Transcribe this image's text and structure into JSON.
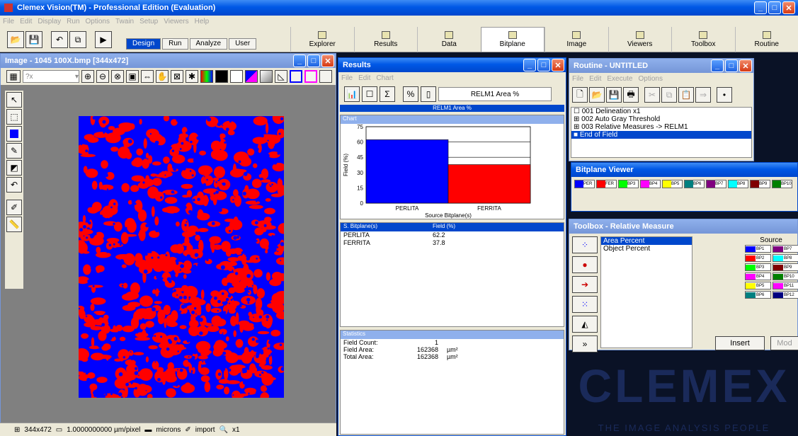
{
  "app": {
    "title": "Clemex Vision(TM) - Professional Edition (Evaluation)",
    "menu": [
      "File",
      "Edit",
      "Display",
      "Run",
      "Options",
      "Twain",
      "Setup",
      "Viewers",
      "Help"
    ]
  },
  "tabs": [
    "Design",
    "Run",
    "Analyze",
    "User"
  ],
  "big_toolbar": [
    {
      "label": "Explorer",
      "icon": "folder-icon"
    },
    {
      "label": "Results",
      "icon": "bar-chart-icon"
    },
    {
      "label": "Data",
      "icon": "data-icon"
    },
    {
      "label": "Bitplane",
      "icon": "bitplane-icon"
    },
    {
      "label": "Image",
      "icon": "image-icon"
    },
    {
      "label": "Viewers",
      "icon": "binoculars-icon"
    },
    {
      "label": "Toolbox",
      "icon": "toolbox-icon"
    },
    {
      "label": "Routine",
      "icon": "routine-icon"
    }
  ],
  "image_window": {
    "title": "Image - 1045 100X.bmp [344x472]",
    "zoom": "?x"
  },
  "statusbar": {
    "dimensions": "344x472",
    "calibration": "1.0000000000 µm/pixel",
    "units": "microns",
    "mode": "import",
    "zoom": "x1"
  },
  "results": {
    "title": "Results",
    "menu": [
      "File",
      "Edit",
      "Chart"
    ],
    "measure": "RELM1 Area %",
    "header_band": "RELM1 Area %",
    "chart_section": "Chart",
    "table_section_cols": [
      "S. Bitplane(s)",
      "Field (%)"
    ],
    "rows": [
      {
        "name": "PERLITA",
        "value": "62.2"
      },
      {
        "name": "FERRITA",
        "value": "37.8"
      }
    ],
    "stats_section": "Statistics",
    "stats": [
      {
        "label": "Field Count:",
        "value": "1",
        "unit": ""
      },
      {
        "label": "Field Area:",
        "value": "162368",
        "unit": "µm²"
      },
      {
        "label": "Total Area:",
        "value": "162368",
        "unit": "µm²"
      }
    ]
  },
  "chart_data": {
    "type": "bar",
    "categories": [
      "PERLITA",
      "FERRITA"
    ],
    "values": [
      62.2,
      37.8
    ],
    "colors": [
      "#0000ff",
      "#ff0000"
    ],
    "xlabel": "Source Bitplane(s)",
    "ylabel": "Field (%)",
    "ylim": [
      0,
      75
    ],
    "yticks": [
      0,
      15,
      30,
      45,
      60,
      75
    ],
    "grid": true
  },
  "routine": {
    "title": "Routine - UNTITLED",
    "menu": [
      "File",
      "Edit",
      "Execute",
      "Options"
    ],
    "items": [
      {
        "prefix": "☐",
        "text": "001  Delineation x1"
      },
      {
        "prefix": "⊞",
        "text": "002  Auto Gray Threshold"
      },
      {
        "prefix": "⊞",
        "text": "003  Relative Measures -> RELM1"
      },
      {
        "prefix": "■",
        "text": "End of Field"
      }
    ]
  },
  "bitplane_viewer": {
    "title": "Bitplane Viewer",
    "chips": [
      {
        "label": "PER",
        "color": "#0000ff"
      },
      {
        "label": "FER",
        "color": "#ff0000"
      },
      {
        "label": "BP3",
        "color": "#00ff00"
      },
      {
        "label": "BP4",
        "color": "#ff00ff"
      },
      {
        "label": "BP5",
        "color": "#ffff00"
      },
      {
        "label": "BP6",
        "color": "#008080"
      },
      {
        "label": "BP7",
        "color": "#800080"
      },
      {
        "label": "BP8",
        "color": "#00ffff"
      },
      {
        "label": "BP9",
        "color": "#800000"
      },
      {
        "label": "BP10",
        "color": "#008000"
      }
    ]
  },
  "toolbox": {
    "title": "Toolbox - Relative Measure",
    "list": [
      "Area Percent",
      "Object Percent"
    ],
    "source_label": "Source",
    "source_chips": [
      {
        "label": "BP1",
        "color": "#0000ff"
      },
      {
        "label": "BP7",
        "color": "#800080"
      },
      {
        "label": "BP2",
        "color": "#ff0000"
      },
      {
        "label": "BP8",
        "color": "#00ffff"
      },
      {
        "label": "BP3",
        "color": "#00ff00"
      },
      {
        "label": "BP9",
        "color": "#800000"
      },
      {
        "label": "BP4",
        "color": "#ff00ff"
      },
      {
        "label": "BP10",
        "color": "#008000"
      },
      {
        "label": "BP5",
        "color": "#ffff00"
      },
      {
        "label": "BP11",
        "color": "#ff00ff"
      },
      {
        "label": "BP6",
        "color": "#008080"
      },
      {
        "label": "BP12",
        "color": "#000080"
      }
    ],
    "insert": "Insert",
    "modify": "Mod"
  },
  "brand": {
    "logo": "CLEMEX",
    "tagline": "THE IMAGE ANALYSIS PEOPLE"
  }
}
